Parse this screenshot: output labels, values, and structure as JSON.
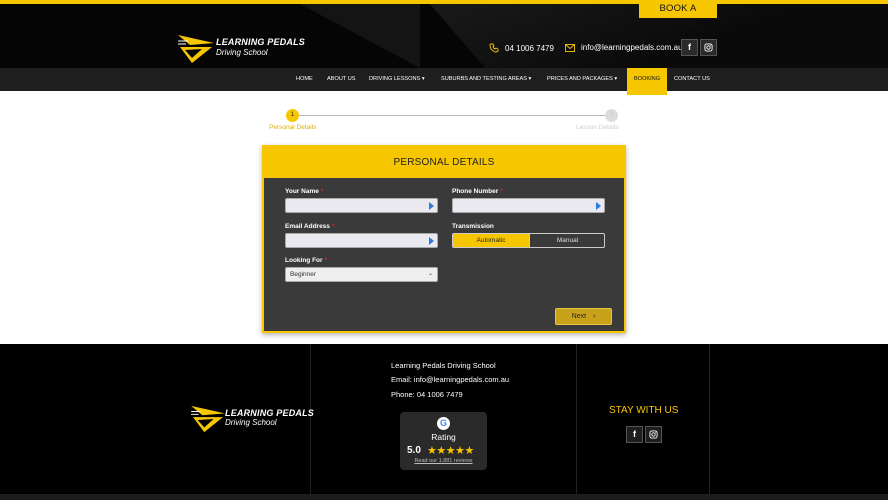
{
  "header": {
    "book_button": "BOOK A LESSON",
    "logo_line1": "LEARNING PEDALS",
    "logo_line2": "Driving School",
    "phone": "04 1006 7479",
    "email": "info@learningpedals.com.au",
    "phone_icon": "phone-icon",
    "email_icon": "envelope-icon",
    "social": [
      "f",
      "◎"
    ]
  },
  "nav": {
    "items": [
      {
        "label": "HOME"
      },
      {
        "label": "ABOUT US"
      },
      {
        "label": "DRIVING LESSONS ▾"
      },
      {
        "label": "SUBURBS AND TESTING AREAS ▾"
      },
      {
        "label": "PRICES AND PACKAGES ▾"
      },
      {
        "label": "BOOKING"
      },
      {
        "label": "CONTACT US"
      }
    ],
    "active_index": 5
  },
  "steps": [
    {
      "number": "1",
      "label": "Personal Details"
    },
    {
      "number": "2",
      "label": "Lesson Details"
    }
  ],
  "form": {
    "title": "PERSONAL DETAILS",
    "name_label": "Your Name",
    "phone_label": "Phone Number",
    "email_label": "Email Address",
    "transmission_label": "Transmission",
    "looking_for_label": "Looking For",
    "required_mark": "*",
    "transmission_options": [
      "Automatic",
      "Manual"
    ],
    "transmission_selected": "Automatic",
    "looking_for_value": "Beginner",
    "next_button": "Next"
  },
  "footer": {
    "logo_line1": "LEARNING PEDALS",
    "logo_line2": "Driving School",
    "school_name": "Learning Pedals Driving School",
    "email_line": "Email: info@learningpedals.com.au",
    "phone_line": "Phone: 04 1006 7479",
    "stay_heading": "STAY WITH US",
    "rating": {
      "label": "Rating",
      "score": "5.0",
      "stars": "★★★★★",
      "reviews_link": "Read our 1,881 reviews"
    }
  },
  "colors": {
    "accent": "#f6c700",
    "header_bg": "#050505",
    "nav_bg": "#1e1e1e",
    "form_bg": "#3a3a3a",
    "footer_bg": "#000000"
  }
}
